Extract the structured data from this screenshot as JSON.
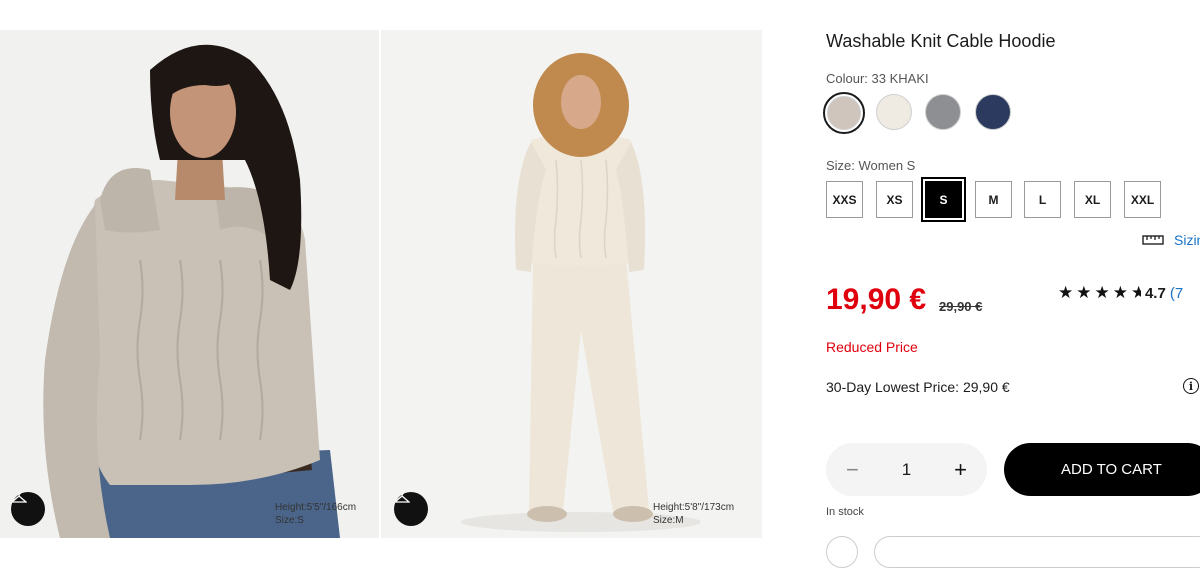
{
  "gallery": {
    "photo1": {
      "model_height": "Height:5'5\"/166cm",
      "model_size": "Size:S"
    },
    "photo2": {
      "model_height": "Height:5'8\"/173cm",
      "model_size": "Size:M"
    },
    "icon": "hanger-icon"
  },
  "product": {
    "title": "Washable Knit Cable Hoodie",
    "colour_label": "Colour: 33 KHAKI",
    "swatches": [
      {
        "color": "#cfc5bc",
        "selected": true
      },
      {
        "color": "#efebe3",
        "selected": false
      },
      {
        "color": "#8e8f92",
        "selected": false
      },
      {
        "color": "#2b3a5e",
        "selected": false
      }
    ],
    "size_label": "Size: Women S",
    "sizes": [
      "XXS",
      "XS",
      "S",
      "M",
      "L",
      "XL",
      "XXL"
    ],
    "selected_size": "S",
    "sizing_link": "Sizing",
    "price": "19,90 €",
    "old_price": "29,90 €",
    "rating": {
      "stars": "★★★★",
      "half_star": "★",
      "value": "4.7",
      "count": "(7"
    },
    "reduced_label": "Reduced Price",
    "lowest_price": "30-Day Lowest Price: 29,90 €",
    "info_icon": "i",
    "quantity": {
      "minus": "−",
      "value": "1",
      "plus": "+"
    },
    "add_to_cart": "ADD TO CART",
    "stock": "In stock"
  },
  "colors": {
    "price_red": "#e0000d",
    "link_blue": "#1a73c6",
    "black": "#000000"
  }
}
